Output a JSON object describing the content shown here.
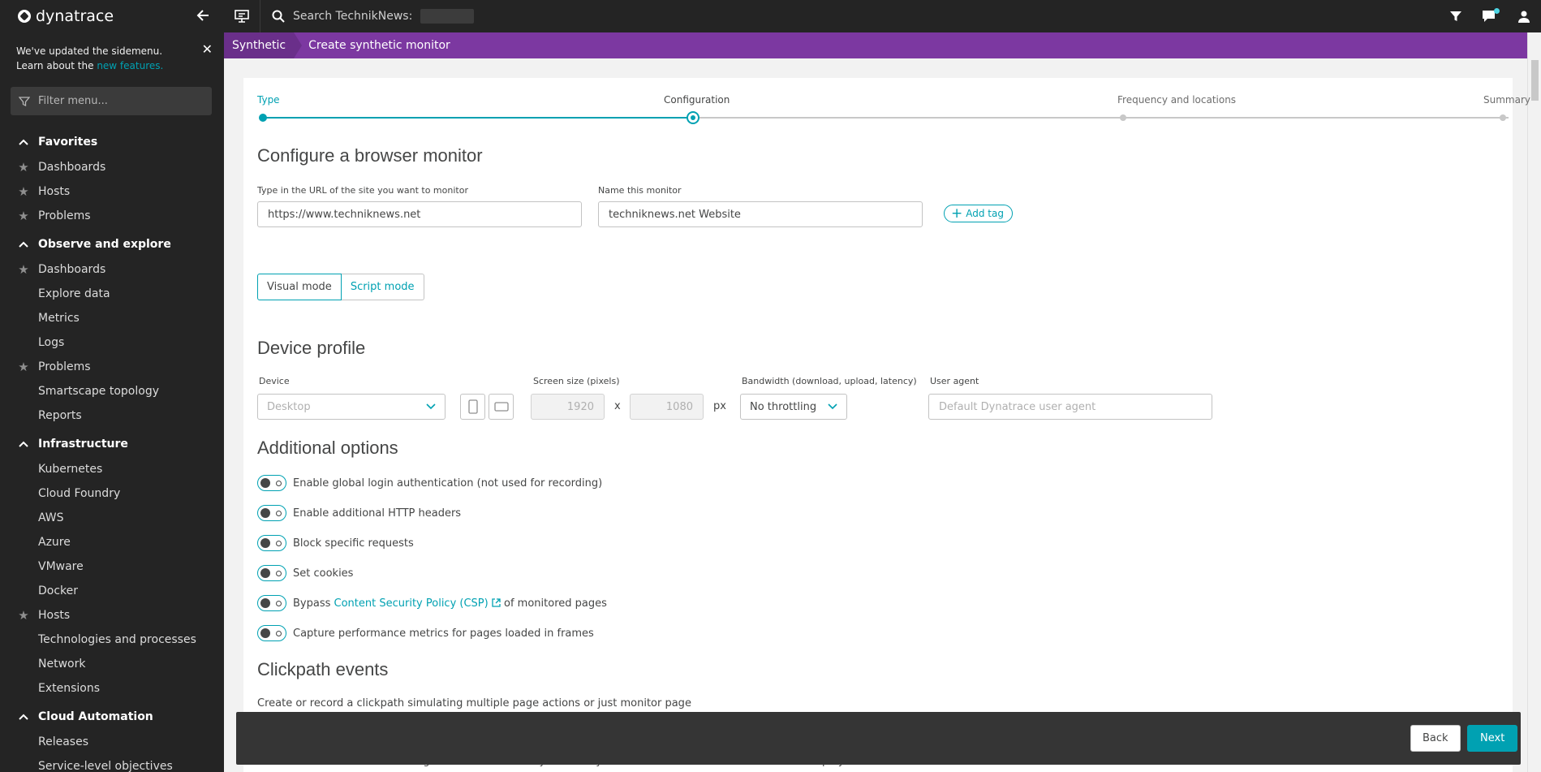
{
  "sidebar": {
    "brand": "dynatrace",
    "notice_text": "We've updated the sidemenu. Learn about the",
    "notice_link": "new features.",
    "filter_placeholder": "Filter menu...",
    "sections": [
      {
        "title": "Favorites",
        "items": [
          {
            "label": "Dashboards",
            "star": true
          },
          {
            "label": "Hosts",
            "star": true
          },
          {
            "label": "Problems",
            "star": true
          }
        ]
      },
      {
        "title": "Observe and explore",
        "items": [
          {
            "label": "Dashboards",
            "star": true
          },
          {
            "label": "Explore data",
            "star": false
          },
          {
            "label": "Metrics",
            "star": false
          },
          {
            "label": "Logs",
            "star": false
          },
          {
            "label": "Problems",
            "star": true
          },
          {
            "label": "Smartscape topology",
            "star": false
          },
          {
            "label": "Reports",
            "star": false
          }
        ]
      },
      {
        "title": "Infrastructure",
        "items": [
          {
            "label": "Kubernetes",
            "star": false
          },
          {
            "label": "Cloud Foundry",
            "star": false
          },
          {
            "label": "AWS",
            "star": false
          },
          {
            "label": "Azure",
            "star": false
          },
          {
            "label": "VMware",
            "star": false
          },
          {
            "label": "Docker",
            "star": false
          },
          {
            "label": "Hosts",
            "star": true
          },
          {
            "label": "Technologies and processes",
            "star": false
          },
          {
            "label": "Network",
            "star": false
          },
          {
            "label": "Extensions",
            "star": false
          }
        ]
      },
      {
        "title": "Cloud Automation",
        "items": [
          {
            "label": "Releases",
            "star": false
          },
          {
            "label": "Service-level objectives",
            "star": false
          }
        ]
      }
    ]
  },
  "topbar": {
    "search_label": "Search TechnikNews:"
  },
  "breadcrumb": {
    "first": "Synthetic",
    "second": "Create synthetic monitor"
  },
  "steps": {
    "type": "Type",
    "configuration": "Configuration",
    "frequency": "Frequency and locations",
    "summary": "Summary"
  },
  "form": {
    "title": "Configure a browser monitor",
    "url_label": "Type in the URL of the site you want to monitor",
    "url_value": "https://www.techniknews.net",
    "name_label": "Name this monitor",
    "name_value": "techniknews.net Website",
    "add_tag": "Add tag",
    "visual_mode": "Visual mode",
    "script_mode": "Script mode"
  },
  "device": {
    "title": "Device profile",
    "device_label": "Device",
    "device_value": "Desktop",
    "screen_label": "Screen size (pixels)",
    "width": "1920",
    "x": "x",
    "height": "1080",
    "px": "px",
    "bandwidth_label": "Bandwidth (download, upload, latency)",
    "bandwidth_value": "No throttling",
    "ua_label": "User agent",
    "ua_placeholder": "Default Dynatrace user agent"
  },
  "options": {
    "title": "Additional options",
    "items": [
      "Enable global login authentication (not used for recording)",
      "Enable additional HTTP headers",
      "Block specific requests",
      "Set cookies"
    ],
    "csp_prefix": "Bypass",
    "csp_link": "Content Security Policy (CSP)",
    "csp_suffix": "of monitored pages",
    "frames": "Capture performance metrics for pages loaded in frames"
  },
  "clickpath": {
    "title": "Clickpath events",
    "desc": "Create or record a clickpath simulating multiple page actions or just monitor page",
    "under_text": "Use Google Chrome and the Dynatrace Synthetic Recorder extension to record and playback."
  },
  "footer": {
    "back": "Back",
    "next": "Next"
  },
  "colors": {
    "accent": "#00a1b2",
    "breadcrumb": "#7c38a1",
    "sidebar": "#242424"
  }
}
